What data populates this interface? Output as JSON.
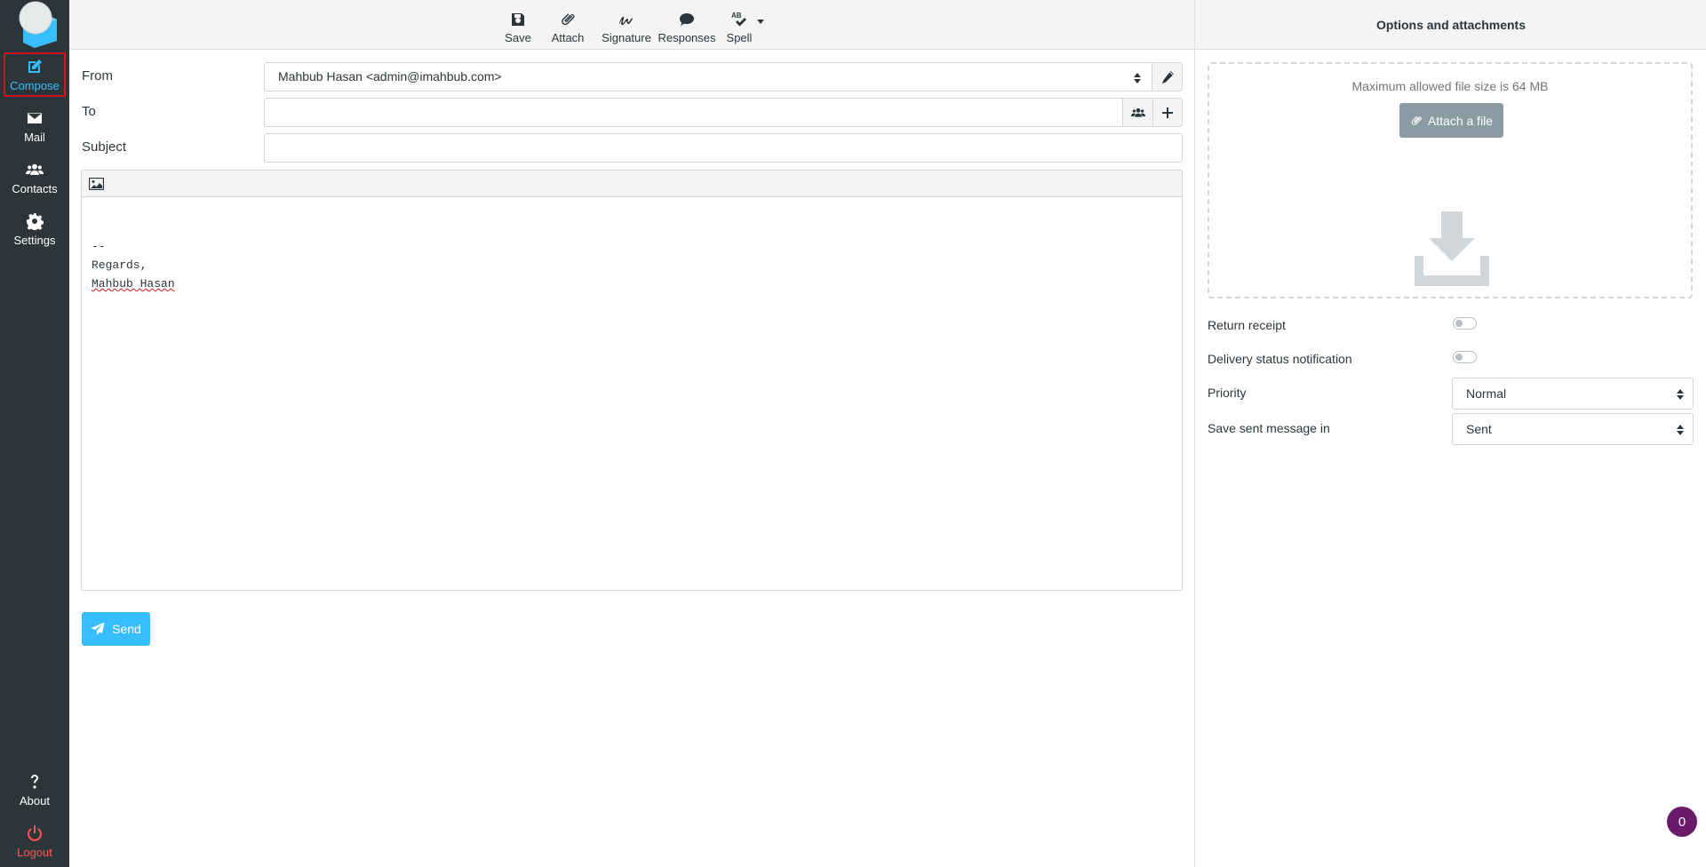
{
  "nav": {
    "compose": "Compose",
    "mail": "Mail",
    "contacts": "Contacts",
    "settings": "Settings",
    "about": "About",
    "logout": "Logout"
  },
  "toolbar": {
    "save": "Save",
    "attach": "Attach",
    "signature": "Signature",
    "responses": "Responses",
    "spell": "Spell"
  },
  "form": {
    "from_label": "From",
    "from_value": "Mahbub Hasan <admin@imahbub.com>",
    "to_label": "To",
    "to_value": "",
    "subject_label": "Subject",
    "subject_value": ""
  },
  "editor": {
    "sig_dash": "--",
    "sig_regards": "Regards,",
    "sig_name": "Mahbub Hasan"
  },
  "send_label": "Send",
  "options": {
    "title": "Options and attachments",
    "max_size": "Maximum allowed file size is 64 MB",
    "attach_file": "Attach a file",
    "return_receipt": "Return receipt",
    "return_receipt_on": false,
    "delivery_status": "Delivery status notification",
    "delivery_status_on": false,
    "priority_label": "Priority",
    "priority_value": "Normal",
    "save_sent_label": "Save sent message in",
    "save_sent_value": "Sent"
  },
  "badge_count": "0",
  "colors": {
    "sidebar_bg": "#2c363a",
    "accent": "#37beff",
    "logout": "#ff5552",
    "badge": "#6a1b6a"
  }
}
